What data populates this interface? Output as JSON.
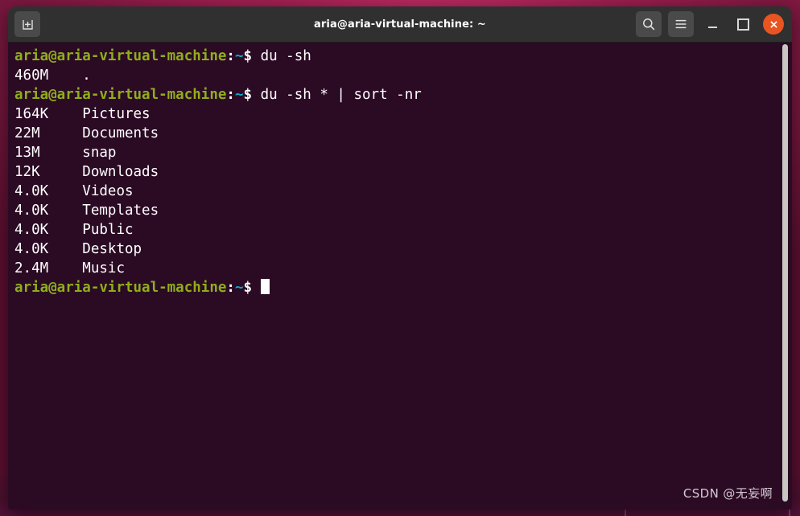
{
  "window": {
    "title": "aria@aria-virtual-machine: ~",
    "new_tab_icon": "new-tab-icon",
    "search_icon": "search-icon",
    "menu_icon": "hamburger-menu-icon",
    "minimize_icon": "minimize-icon",
    "maximize_icon": "maximize-icon",
    "close_icon": "close-icon",
    "close_color": "#e95420",
    "titlebar_color": "#303030"
  },
  "terminal": {
    "background_color": "#2b0a24",
    "prompt_color": "#8fae1b",
    "path_color": "#0fa5c8",
    "text_color": "#ffffff",
    "user_host": "aria@aria-virtual-machine",
    "colon": ":",
    "path": "~",
    "dollar": "$",
    "lines": [
      {
        "type": "prompt",
        "command": "du -sh"
      },
      {
        "type": "output",
        "size": "460M",
        "name": "."
      },
      {
        "type": "prompt",
        "command": "du -sh * | sort -nr"
      },
      {
        "type": "output",
        "size": "164K",
        "name": "Pictures"
      },
      {
        "type": "output",
        "size": "22M",
        "name": "Documents"
      },
      {
        "type": "output",
        "size": "13M",
        "name": "snap"
      },
      {
        "type": "output",
        "size": "12K",
        "name": "Downloads"
      },
      {
        "type": "output",
        "size": "4.0K",
        "name": "Videos"
      },
      {
        "type": "output",
        "size": "4.0K",
        "name": "Templates"
      },
      {
        "type": "output",
        "size": "4.0K",
        "name": "Public"
      },
      {
        "type": "output",
        "size": "4.0K",
        "name": "Desktop"
      },
      {
        "type": "output",
        "size": "2.4M",
        "name": "Music"
      },
      {
        "type": "prompt",
        "command": "",
        "cursor": true
      }
    ]
  },
  "watermark": {
    "text": "CSDN @无妄啊"
  }
}
